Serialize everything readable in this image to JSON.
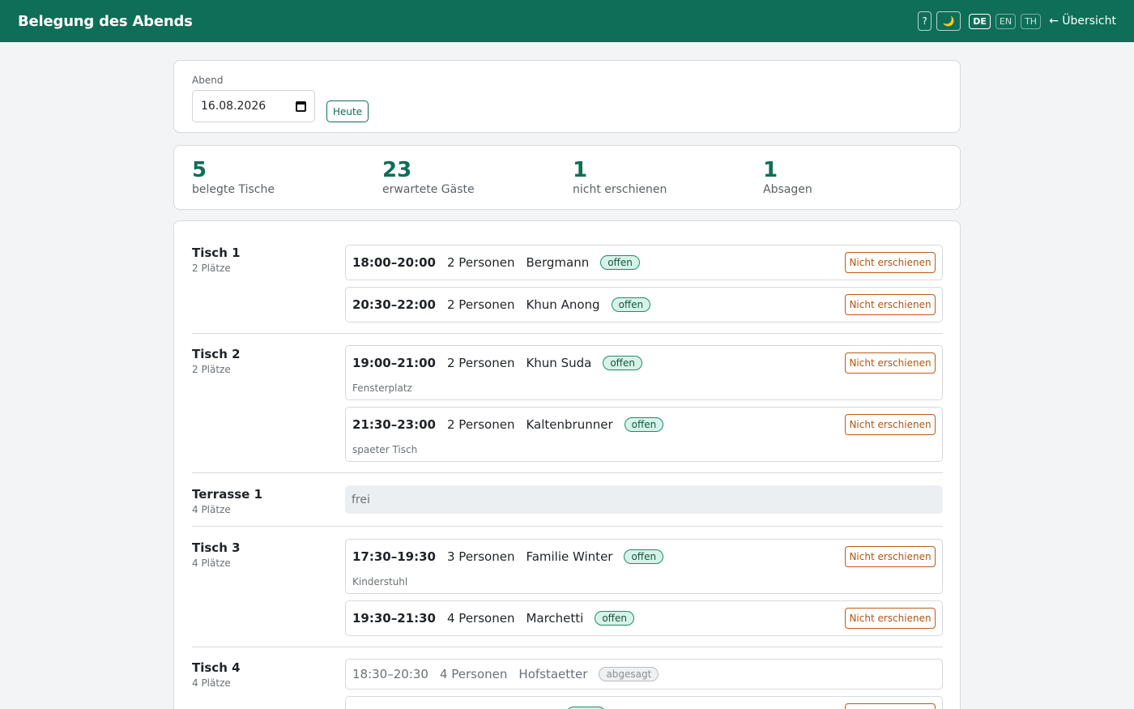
{
  "header": {
    "title": "Belegung des Abends",
    "help_label": "?",
    "theme_toggle_icon": "moon-icon",
    "theme_toggle_glyph": "🌙",
    "languages": [
      {
        "code": "DE",
        "active": true
      },
      {
        "code": "EN",
        "active": false
      },
      {
        "code": "TH",
        "active": false
      }
    ],
    "back_label": "← Übersicht"
  },
  "date_picker": {
    "label": "Abend",
    "value": "16.08.2026",
    "today_label": "Heute"
  },
  "stats": [
    {
      "value": "5",
      "label": "belegte Tische"
    },
    {
      "value": "23",
      "label": "erwartete Gäste"
    },
    {
      "value": "1",
      "label": "nicht erschienen"
    },
    {
      "value": "1",
      "label": "Absagen"
    }
  ],
  "labels": {
    "no_show_button": "Nicht erschienen",
    "free": "frei"
  },
  "tables": [
    {
      "name": "Tisch 1",
      "seats": "2 Plätze",
      "reservations": [
        {
          "time": "18:00–20:00",
          "persons": "2 Personen",
          "name": "Bergmann",
          "status": "offen",
          "note": ""
        },
        {
          "time": "20:30–22:00",
          "persons": "2 Personen",
          "name": "Khun Anong",
          "status": "offen",
          "note": ""
        }
      ]
    },
    {
      "name": "Tisch 2",
      "seats": "2 Plätze",
      "reservations": [
        {
          "time": "19:00–21:00",
          "persons": "2 Personen",
          "name": "Khun Suda",
          "status": "offen",
          "note": "Fensterplatz"
        },
        {
          "time": "21:30–23:00",
          "persons": "2 Personen",
          "name": "Kaltenbrunner",
          "status": "offen",
          "note": "spaeter Tisch"
        }
      ]
    },
    {
      "name": "Terrasse 1",
      "seats": "4 Plätze",
      "reservations": []
    },
    {
      "name": "Tisch 3",
      "seats": "4 Plätze",
      "reservations": [
        {
          "time": "17:30–19:30",
          "persons": "3 Personen",
          "name": "Familie Winter",
          "status": "offen",
          "note": "Kinderstuhl"
        },
        {
          "time": "19:30–21:30",
          "persons": "4 Personen",
          "name": "Marchetti",
          "status": "offen",
          "note": ""
        }
      ]
    },
    {
      "name": "Tisch 4",
      "seats": "4 Plätze",
      "reservations": [
        {
          "time": "18:30–20:30",
          "persons": "4 Personen",
          "name": "Hofstaetter",
          "status": "abgesagt",
          "note": ""
        },
        {
          "time": "",
          "persons": "",
          "name": "",
          "status": "offen",
          "note": ""
        }
      ]
    }
  ],
  "colors": {
    "brand": "#0f6e57",
    "badge_open_bg": "#d7f3e8",
    "no_show": "#c25a12"
  }
}
